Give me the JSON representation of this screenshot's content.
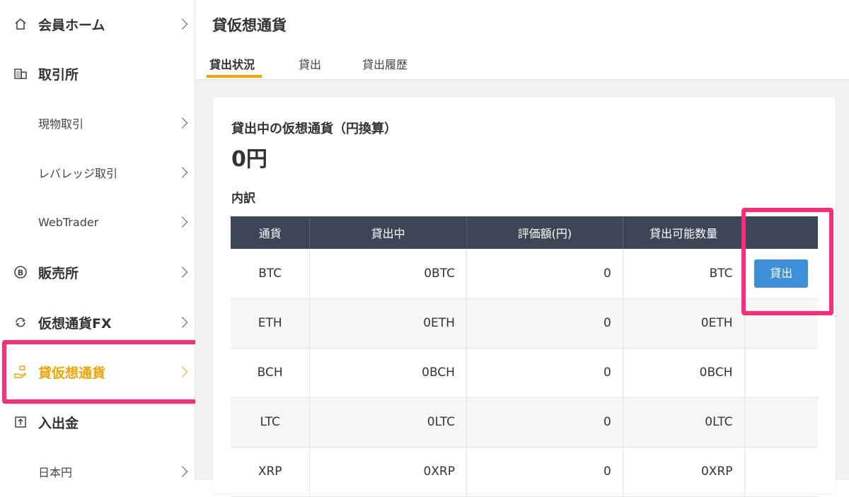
{
  "sidebar": {
    "items": [
      {
        "label": "会員ホーム",
        "icon": "home-icon"
      },
      {
        "label": "取引所",
        "icon": "building-icon"
      },
      {
        "label": "現物取引"
      },
      {
        "label": "レバレッジ取引"
      },
      {
        "label": "WebTrader"
      },
      {
        "label": "販売所",
        "icon": "bitcoin-icon"
      },
      {
        "label": "仮想通貨FX",
        "icon": "exchange-arrows-icon"
      },
      {
        "label": "貸仮想通貨",
        "icon": "hand-coin-icon"
      },
      {
        "label": "入出金",
        "icon": "deposit-box-icon"
      },
      {
        "label": "日本円"
      }
    ]
  },
  "header": {
    "title": "貸仮想通貨",
    "tabs": [
      {
        "label": "貸出状況"
      },
      {
        "label": "貸出"
      },
      {
        "label": "貸出履歴"
      }
    ]
  },
  "card": {
    "title": "貸出中の仮想通貨（円換算）",
    "total": "0円",
    "breakdown_label": "内訳"
  },
  "table": {
    "headers": [
      "通貨",
      "貸出中",
      "評価額(円)",
      "貸出可能数量",
      ""
    ],
    "rows": [
      {
        "currency": "BTC",
        "lending": "0BTC",
        "value": "0",
        "available": "BTC",
        "action": "貸出"
      },
      {
        "currency": "ETH",
        "lending": "0ETH",
        "value": "0",
        "available": "0ETH",
        "action": ""
      },
      {
        "currency": "BCH",
        "lending": "0BCH",
        "value": "0",
        "available": "0BCH",
        "action": ""
      },
      {
        "currency": "LTC",
        "lending": "0LTC",
        "value": "0",
        "available": "0LTC",
        "action": ""
      },
      {
        "currency": "XRP",
        "lending": "0XRP",
        "value": "0",
        "available": "0XRP",
        "action": ""
      }
    ]
  },
  "colors": {
    "accent": "#f5a300",
    "highlight": "#ff2d78",
    "table_header": "#3d4654",
    "button": "#3d8fd8"
  }
}
